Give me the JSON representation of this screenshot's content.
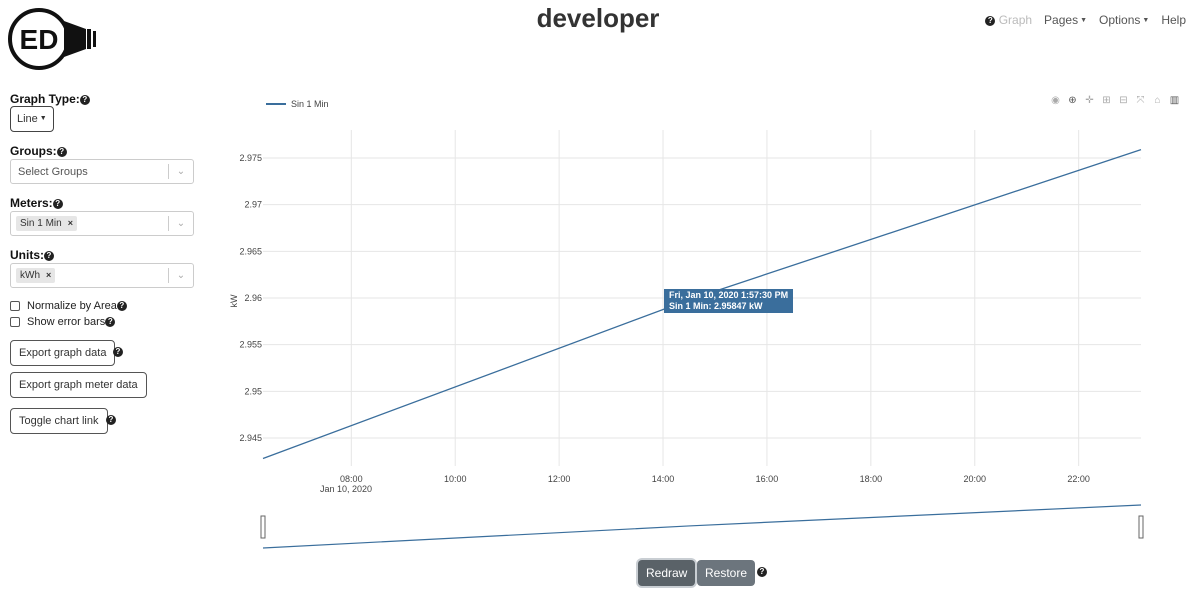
{
  "header": {
    "logo_text": "ED",
    "title": "developer",
    "nav": {
      "graph": "Graph",
      "pages": "Pages",
      "options": "Options",
      "help": "Help"
    }
  },
  "sidebar": {
    "graph_type_label": "Graph Type:",
    "graph_type_value": "Line",
    "groups_label": "Groups:",
    "groups_placeholder": "Select Groups",
    "meters_label": "Meters:",
    "meters_selected": [
      "Sin 1 Min"
    ],
    "units_label": "Units:",
    "units_selected": [
      "kWh"
    ],
    "normalize_label": "Normalize by Area",
    "error_bars_label": "Show error bars",
    "export_data_label": "Export graph data",
    "export_meter_label": "Export graph meter data",
    "toggle_link_label": "Toggle chart link"
  },
  "chart_data": {
    "type": "line",
    "ylabel": "kW",
    "xlabel": "",
    "x_tick_labels": [
      "08:00",
      "10:00",
      "12:00",
      "14:00",
      "16:00",
      "18:00",
      "20:00",
      "22:00"
    ],
    "x_date_label": "Jan 10, 2020",
    "y_tick_labels": [
      "2.945",
      "2.95",
      "2.955",
      "2.96",
      "2.965",
      "2.97",
      "2.975"
    ],
    "ylim": [
      2.942,
      2.978
    ],
    "xlim_hours": [
      6.3,
      23.2
    ],
    "series": [
      {
        "name": "Sin 1 Min",
        "color": "#3a6e9c",
        "x_hours": [
          6.3,
          14.5,
          23.2
        ],
        "values": [
          2.9428,
          2.9598,
          2.9759
        ]
      }
    ],
    "legend_position": "top-left",
    "grid": true,
    "tooltip": {
      "line1": "Fri, Jan 10, 2020 1:57:30 PM",
      "line2": "Sin 1 Min: 2.95847 kW"
    }
  },
  "buttons": {
    "redraw": "Redraw",
    "restore": "Restore"
  }
}
